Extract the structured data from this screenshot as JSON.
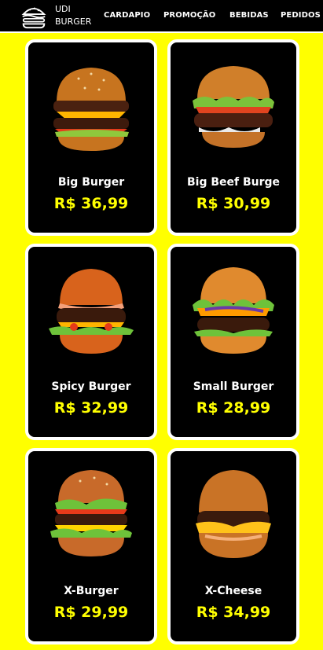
{
  "brand": {
    "line1": "UDI",
    "line2": "BURGER"
  },
  "nav": [
    {
      "label": "CARDAPIO"
    },
    {
      "label": "PROMOÇÃO"
    },
    {
      "label": "BEBIDAS"
    },
    {
      "label": "PEDIDOS"
    }
  ],
  "colors": {
    "background": "#ffff00",
    "card": "#000000",
    "price": "#ffff00",
    "border": "#ffffff"
  },
  "products": [
    {
      "name": "Big Burger",
      "price": "R$ 36,99",
      "image": "double-burger-image"
    },
    {
      "name": "Big Beef Burge",
      "price": "R$ 30,99",
      "image": "beef-burger-image"
    },
    {
      "name": "Spicy Burger",
      "price": "R$ 32,99",
      "image": "spicy-burger-image"
    },
    {
      "name": "Small Burger",
      "price": "R$ 28,99",
      "image": "small-burger-image"
    },
    {
      "name": "X-Burger",
      "price": "R$ 29,99",
      "image": "x-burger-image"
    },
    {
      "name": "X-Cheese",
      "price": "R$ 34,99",
      "image": "x-cheese-image"
    }
  ]
}
